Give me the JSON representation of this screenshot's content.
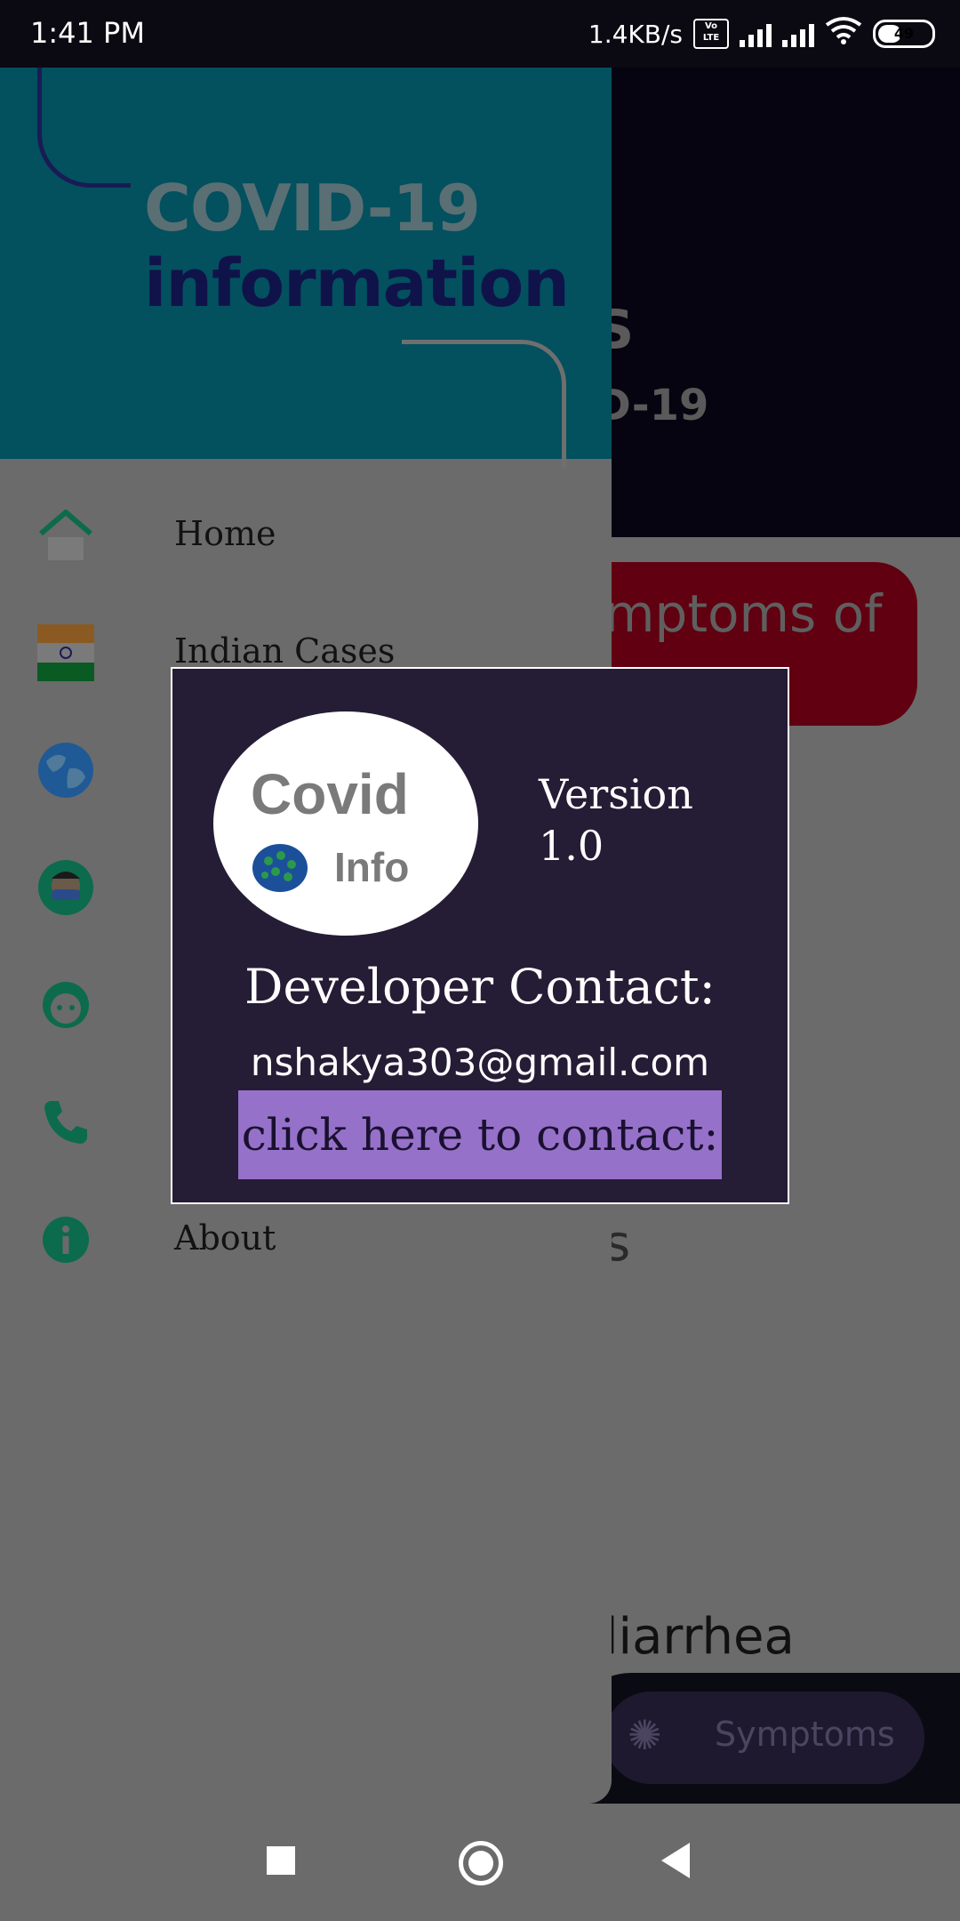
{
  "status_bar": {
    "time": "1:41 PM",
    "net_speed": "1.4KB/s",
    "volte": "Vo LTE",
    "net_type": "4G",
    "battery": "49"
  },
  "background_app": {
    "header_fragment_1": "S",
    "header_fragment_2": "D-19",
    "card_fragment": "mptoms of",
    "section_fragment": "s",
    "list_fragment": "liarrhea",
    "bottom_nav_label": "Symptoms",
    "bottom_nav_icon": "virus-icon"
  },
  "drawer": {
    "title_line1": "COVID-19",
    "title_line2": "information",
    "items": [
      {
        "label": "Home",
        "icon": "home-icon"
      },
      {
        "label": "Indian Cases",
        "icon": "india-flag-icon"
      },
      {
        "label": "",
        "icon": "globe-icon"
      },
      {
        "label": "",
        "icon": "masked-person-icon"
      },
      {
        "label": "",
        "icon": "face-icon"
      },
      {
        "label": "",
        "icon": "phone-icon"
      },
      {
        "label": "About",
        "icon": "info-icon"
      }
    ]
  },
  "dialog": {
    "logo_word1": "Covid",
    "logo_word2": "Info",
    "version_label": "Version",
    "version_number": "1.0",
    "developer_label": "Developer Contact:",
    "email": "nshakya303@gmail.com",
    "contact_button": "click here to contact:"
  },
  "colors": {
    "drawer_header": "#03505f",
    "dialog_bg": "#251c35",
    "contact_button": "#9671c9",
    "icon_green": "#0c6b4c"
  }
}
